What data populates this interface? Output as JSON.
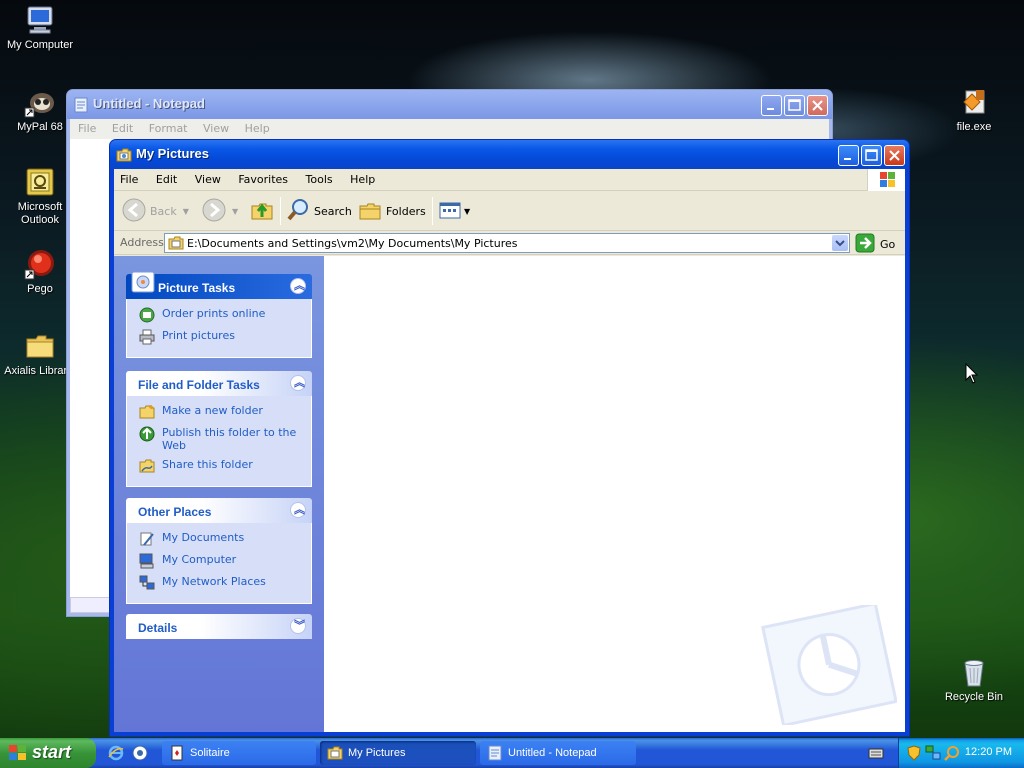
{
  "desktop": {
    "icons": [
      {
        "label": "My Computer",
        "icon": "computer-icon"
      },
      {
        "label": "MyPal 68",
        "icon": "mypal-icon"
      },
      {
        "label": "Microsoft Outlook",
        "icon": "outlook-icon"
      },
      {
        "label": "Pego",
        "icon": "pego-icon"
      },
      {
        "label": "Axialis Librarie",
        "icon": "folder-icon"
      },
      {
        "label": "file.exe",
        "icon": "installer-icon"
      },
      {
        "label": "Recycle Bin",
        "icon": "recycle-bin-icon"
      }
    ]
  },
  "notepad": {
    "title": "Untitled - Notepad",
    "menu": [
      "File",
      "Edit",
      "Format",
      "View",
      "Help"
    ]
  },
  "explorer": {
    "title": "My Pictures",
    "menu": [
      "File",
      "Edit",
      "View",
      "Favorites",
      "Tools",
      "Help"
    ],
    "toolbar": {
      "back": "Back",
      "search": "Search",
      "folders": "Folders"
    },
    "address": {
      "label": "Address",
      "value": "E:\\Documents and Settings\\vm2\\My Documents\\My Pictures",
      "go": "Go"
    },
    "panels": [
      {
        "title": "Picture Tasks",
        "items": [
          "Order prints online",
          "Print pictures"
        ]
      },
      {
        "title": "File and Folder Tasks",
        "items": [
          "Make a new folder",
          "Publish this folder to the Web",
          "Share this folder"
        ]
      },
      {
        "title": "Other Places",
        "items": [
          "My Documents",
          "My Computer",
          "My Network Places"
        ]
      },
      {
        "title": "Details",
        "items": []
      }
    ]
  },
  "taskbar": {
    "start": "start",
    "tasks": [
      "Solitaire",
      "My Pictures",
      "Untitled - Notepad"
    ],
    "active_task": "My Pictures",
    "clock": "12:20 PM"
  },
  "colors": {
    "titlebar_active": "#0a58e6",
    "task_link": "#215dc6",
    "taskbar": "#2157d7",
    "start_button": "#389438"
  }
}
